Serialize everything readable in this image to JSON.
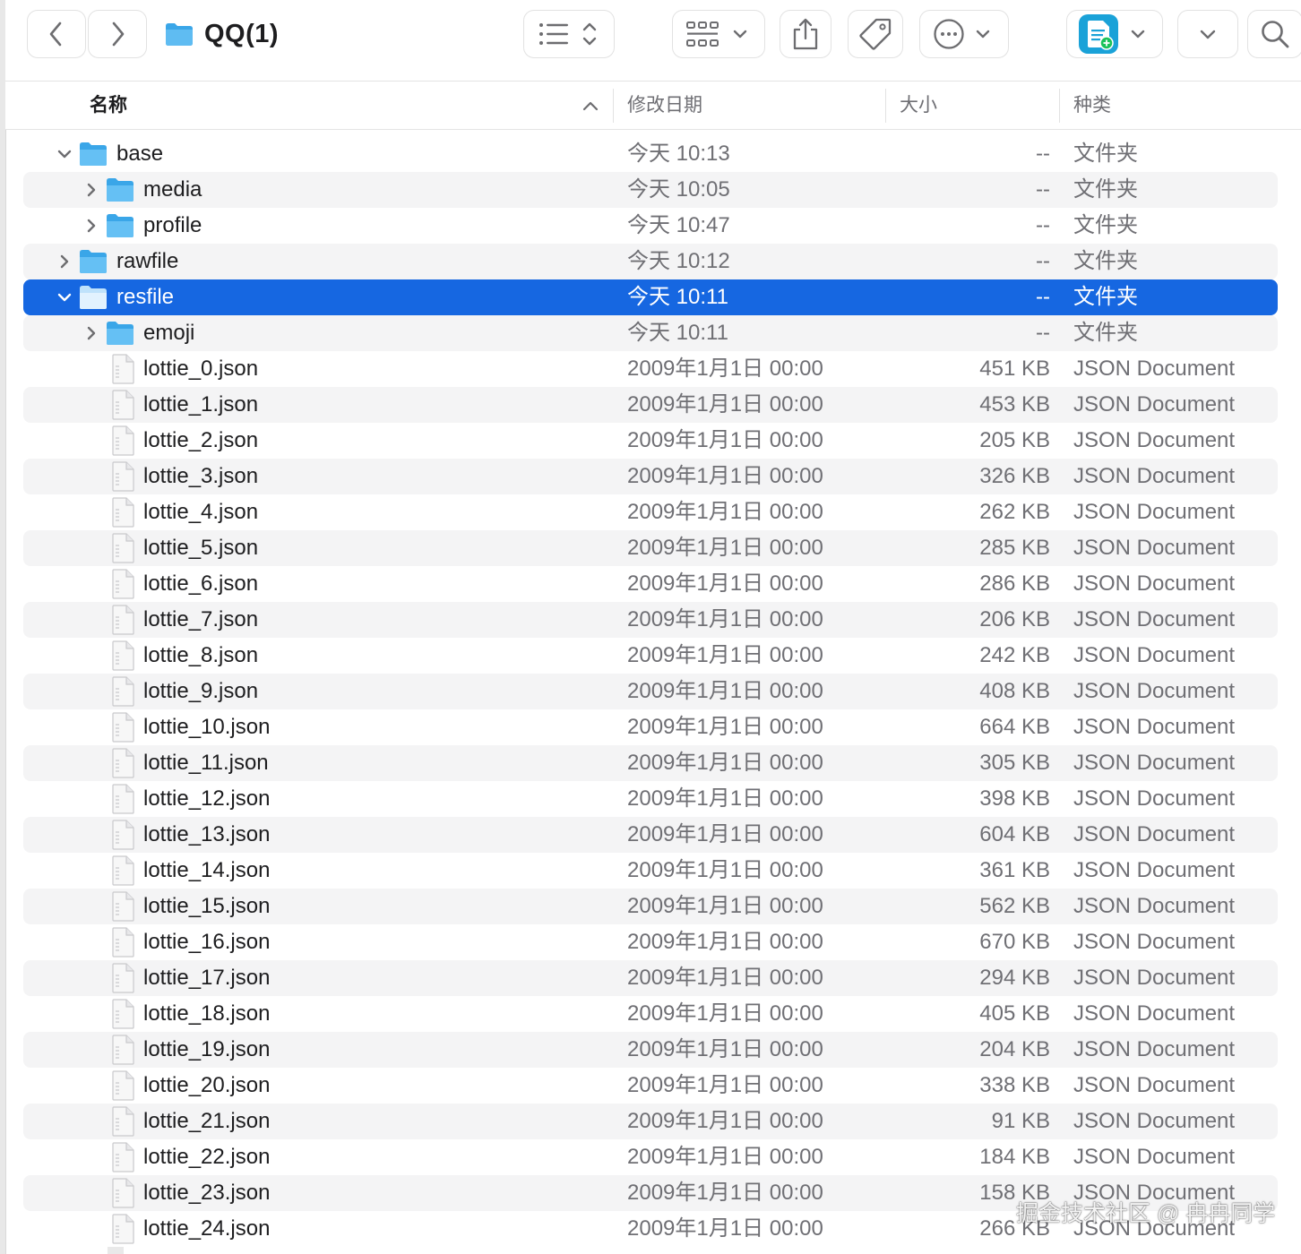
{
  "window": {
    "title": "QQ(1)"
  },
  "toolbar": {
    "back": "back",
    "forward": "forward",
    "view_mode": "list-view",
    "group": "group-by",
    "share": "share",
    "tag": "tag",
    "more": "more-actions",
    "app": "app-shortcut",
    "expand": "expand",
    "search": "search"
  },
  "columns": {
    "name": "名称",
    "date": "修改日期",
    "size": "大小",
    "kind": "种类"
  },
  "accent": "#1667e1",
  "rows": [
    {
      "name": "base",
      "date": "今天 10:13",
      "size": "--",
      "kind": "文件夹",
      "type": "folder",
      "depth": 0,
      "disclosure": "open"
    },
    {
      "name": "media",
      "date": "今天 10:05",
      "size": "--",
      "kind": "文件夹",
      "type": "folder",
      "depth": 1,
      "disclosure": "closed"
    },
    {
      "name": "profile",
      "date": "今天 10:47",
      "size": "--",
      "kind": "文件夹",
      "type": "folder",
      "depth": 1,
      "disclosure": "closed"
    },
    {
      "name": "rawfile",
      "date": "今天 10:12",
      "size": "--",
      "kind": "文件夹",
      "type": "folder",
      "depth": 0,
      "disclosure": "closed"
    },
    {
      "name": "resfile",
      "date": "今天 10:11",
      "size": "--",
      "kind": "文件夹",
      "type": "folder",
      "depth": 0,
      "disclosure": "open",
      "selected": true
    },
    {
      "name": "emoji",
      "date": "今天 10:11",
      "size": "--",
      "kind": "文件夹",
      "type": "folder",
      "depth": 1,
      "disclosure": "closed"
    },
    {
      "name": "lottie_0.json",
      "date": "2009年1月1日 00:00",
      "size": "451 KB",
      "kind": "JSON Document",
      "type": "file",
      "depth": 1
    },
    {
      "name": "lottie_1.json",
      "date": "2009年1月1日 00:00",
      "size": "453 KB",
      "kind": "JSON Document",
      "type": "file",
      "depth": 1
    },
    {
      "name": "lottie_2.json",
      "date": "2009年1月1日 00:00",
      "size": "205 KB",
      "kind": "JSON Document",
      "type": "file",
      "depth": 1
    },
    {
      "name": "lottie_3.json",
      "date": "2009年1月1日 00:00",
      "size": "326 KB",
      "kind": "JSON Document",
      "type": "file",
      "depth": 1
    },
    {
      "name": "lottie_4.json",
      "date": "2009年1月1日 00:00",
      "size": "262 KB",
      "kind": "JSON Document",
      "type": "file",
      "depth": 1
    },
    {
      "name": "lottie_5.json",
      "date": "2009年1月1日 00:00",
      "size": "285 KB",
      "kind": "JSON Document",
      "type": "file",
      "depth": 1
    },
    {
      "name": "lottie_6.json",
      "date": "2009年1月1日 00:00",
      "size": "286 KB",
      "kind": "JSON Document",
      "type": "file",
      "depth": 1
    },
    {
      "name": "lottie_7.json",
      "date": "2009年1月1日 00:00",
      "size": "206 KB",
      "kind": "JSON Document",
      "type": "file",
      "depth": 1
    },
    {
      "name": "lottie_8.json",
      "date": "2009年1月1日 00:00",
      "size": "242 KB",
      "kind": "JSON Document",
      "type": "file",
      "depth": 1
    },
    {
      "name": "lottie_9.json",
      "date": "2009年1月1日 00:00",
      "size": "408 KB",
      "kind": "JSON Document",
      "type": "file",
      "depth": 1
    },
    {
      "name": "lottie_10.json",
      "date": "2009年1月1日 00:00",
      "size": "664 KB",
      "kind": "JSON Document",
      "type": "file",
      "depth": 1
    },
    {
      "name": "lottie_11.json",
      "date": "2009年1月1日 00:00",
      "size": "305 KB",
      "kind": "JSON Document",
      "type": "file",
      "depth": 1
    },
    {
      "name": "lottie_12.json",
      "date": "2009年1月1日 00:00",
      "size": "398 KB",
      "kind": "JSON Document",
      "type": "file",
      "depth": 1
    },
    {
      "name": "lottie_13.json",
      "date": "2009年1月1日 00:00",
      "size": "604 KB",
      "kind": "JSON Document",
      "type": "file",
      "depth": 1
    },
    {
      "name": "lottie_14.json",
      "date": "2009年1月1日 00:00",
      "size": "361 KB",
      "kind": "JSON Document",
      "type": "file",
      "depth": 1
    },
    {
      "name": "lottie_15.json",
      "date": "2009年1月1日 00:00",
      "size": "562 KB",
      "kind": "JSON Document",
      "type": "file",
      "depth": 1
    },
    {
      "name": "lottie_16.json",
      "date": "2009年1月1日 00:00",
      "size": "670 KB",
      "kind": "JSON Document",
      "type": "file",
      "depth": 1
    },
    {
      "name": "lottie_17.json",
      "date": "2009年1月1日 00:00",
      "size": "294 KB",
      "kind": "JSON Document",
      "type": "file",
      "depth": 1
    },
    {
      "name": "lottie_18.json",
      "date": "2009年1月1日 00:00",
      "size": "405 KB",
      "kind": "JSON Document",
      "type": "file",
      "depth": 1
    },
    {
      "name": "lottie_19.json",
      "date": "2009年1月1日 00:00",
      "size": "204 KB",
      "kind": "JSON Document",
      "type": "file",
      "depth": 1
    },
    {
      "name": "lottie_20.json",
      "date": "2009年1月1日 00:00",
      "size": "338 KB",
      "kind": "JSON Document",
      "type": "file",
      "depth": 1
    },
    {
      "name": "lottie_21.json",
      "date": "2009年1月1日 00:00",
      "size": "91 KB",
      "kind": "JSON Document",
      "type": "file",
      "depth": 1
    },
    {
      "name": "lottie_22.json",
      "date": "2009年1月1日 00:00",
      "size": "184 KB",
      "kind": "JSON Document",
      "type": "file",
      "depth": 1
    },
    {
      "name": "lottie_23.json",
      "date": "2009年1月1日 00:00",
      "size": "158 KB",
      "kind": "JSON Document",
      "type": "file",
      "depth": 1
    },
    {
      "name": "lottie_24.json",
      "date": "2009年1月1日 00:00",
      "size": "266 KB",
      "kind": "JSON Document",
      "type": "file",
      "depth": 1
    }
  ],
  "watermark": "掘金技术社区 @ 冉冉同学"
}
